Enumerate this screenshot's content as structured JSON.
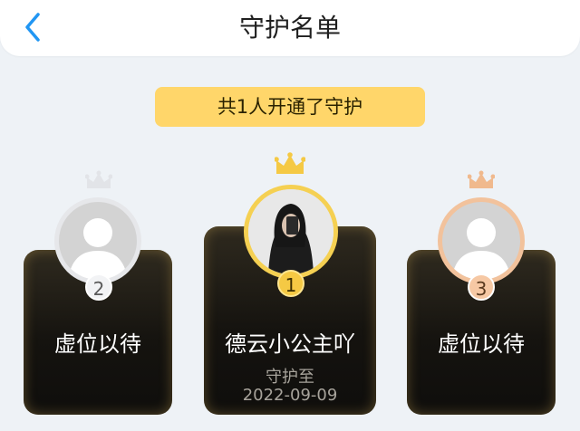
{
  "header": {
    "title": "守护名单",
    "back_icon": "chevron-left-icon",
    "accent": "#2196f3"
  },
  "banner": {
    "text": "共1人开通了守护",
    "color": "#ffd66a"
  },
  "guardians": [
    {
      "rank": "2",
      "name": "虚位以待",
      "crown_color": "#e2e4e8",
      "ring_color": "#e6e7ea",
      "avatar": "default-avatar"
    },
    {
      "rank": "1",
      "name": "德云小公主吖",
      "crown_color": "#f5c944",
      "ring_color": "#f5d052",
      "avatar": "user-photo",
      "until_label": "守护至",
      "until_date": "2022-09-09"
    },
    {
      "rank": "3",
      "name": "虚位以待",
      "crown_color": "#f0b98d",
      "ring_color": "#f2c29c",
      "avatar": "default-avatar"
    }
  ]
}
